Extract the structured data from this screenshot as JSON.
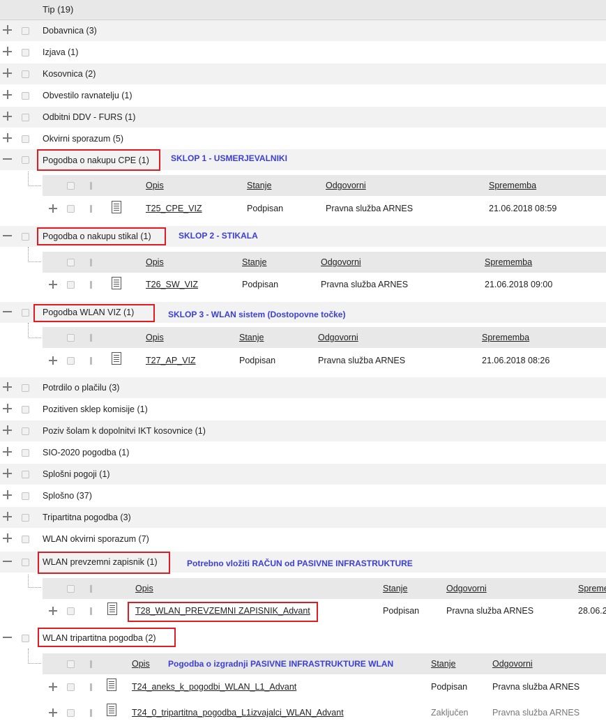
{
  "header": {
    "title": "Tip (19)"
  },
  "groups_top": [
    "Dobavnica (3)",
    "Izjava (1)",
    "Kosovnica (2)",
    "Obvestilo ravnatelju (1)",
    "Odbitni DDV - FURS (1)",
    "Okvirni sporazum (5)"
  ],
  "g1": {
    "label": "Pogodba o nakupu CPE (1)",
    "note": "SKLOP 1 - USMERJEVALNIKI",
    "cols": [
      "Opis",
      "Stanje",
      "Odgovorni",
      "Sprememba"
    ],
    "row": [
      "T25_CPE_VIZ",
      "Podpisan",
      "Pravna služba ARNES",
      "21.06.2018 08:59"
    ]
  },
  "g2": {
    "label": "Pogodba o nakupu stikal (1)",
    "note": "SKLOP 2 - STIKALA",
    "cols": [
      "Opis",
      "Stanje",
      "Odgovorni",
      "Sprememba"
    ],
    "row": [
      "T26_SW_VIZ",
      "Podpisan",
      "Pravna služba ARNES",
      "21.06.2018 09:00"
    ]
  },
  "g3": {
    "label": "Pogodba WLAN VIZ (1)",
    "note": "SKLOP 3 - WLAN sistem (Dostopovne točke)",
    "cols": [
      "Opis",
      "Stanje",
      "Odgovorni",
      "Sprememba"
    ],
    "row": [
      "T27_AP_VIZ",
      "Podpisan",
      "Pravna služba ARNES",
      "21.06.2018 08:26"
    ]
  },
  "groups_mid": [
    "Potrdilo o plačilu (3)",
    "Pozitiven sklep komisije (1)",
    "Poziv šolam k dopolnitvi IKT kosovnice (1)",
    "SIO-2020 pogodba (1)",
    "Splošni pogoji (1)",
    "Splošno (37)",
    "Tripartitna pogodba (3)",
    "WLAN okvirni sporazum (7)"
  ],
  "g4": {
    "label": "WLAN prevzemni zapisnik (1)",
    "note": "Potrebno vložiti RAČUN od PASIVNE INFRASTRUKTURE",
    "cols": [
      "Opis",
      "Stanje",
      "Odgovorni",
      "Spremem"
    ],
    "row": [
      "T28_WLAN_PREVZEMNI ZAPISNIK_Advant",
      "Podpisan",
      "Pravna služba ARNES",
      "28.06.2"
    ]
  },
  "g5": {
    "label": "WLAN tripartitna pogodba (2)",
    "note": "Pogodba o izgradnji PASIVNE INFRASTRUKTURE WLAN",
    "cols": [
      "Opis",
      "Stanje",
      "Odgovorni"
    ],
    "rows": [
      [
        "T24_aneks_k_pogodbi_WLAN_L1_Advant",
        "Podpisan",
        "Pravna služba ARNES"
      ],
      [
        "T24_0_tripartitna_pogodba_L1izvajalci_WLAN_Advant",
        "Zaključen",
        "Pravna služba ARNES"
      ]
    ]
  },
  "colors": {
    "highlight": "#e01b24",
    "note": "#3a3fd6",
    "header_bg": "#e8e8e8"
  }
}
